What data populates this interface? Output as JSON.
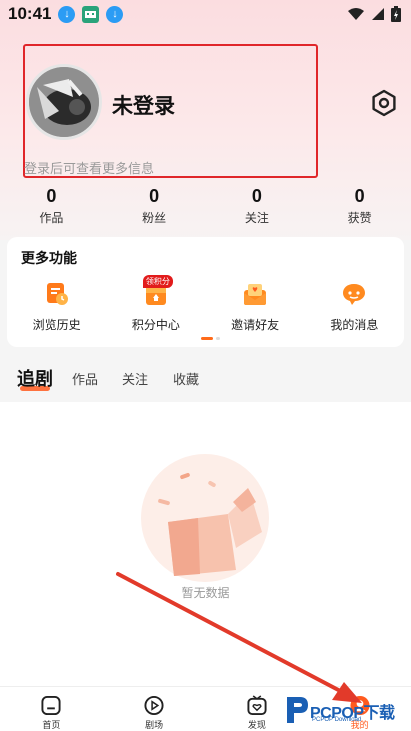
{
  "status_bar": {
    "time": "10:41",
    "left_icons": [
      "download-icon",
      "app-icon",
      "download-icon"
    ],
    "right_icons": [
      "wifi-icon",
      "signal-icon",
      "battery-icon"
    ]
  },
  "profile": {
    "nickname": "未登录",
    "login_hint": "登录后可查看更多信息"
  },
  "stats": [
    {
      "value": "0",
      "label": "作品"
    },
    {
      "value": "0",
      "label": "粉丝"
    },
    {
      "value": "0",
      "label": "关注"
    },
    {
      "value": "0",
      "label": "获赞"
    }
  ],
  "more_functions": {
    "title": "更多功能",
    "items": [
      {
        "label": "浏览历史",
        "icon": "history-icon"
      },
      {
        "label": "积分中心",
        "icon": "points-icon",
        "badge": "领积分"
      },
      {
        "label": "邀请好友",
        "icon": "invite-icon"
      },
      {
        "label": "我的消息",
        "icon": "message-icon"
      }
    ]
  },
  "content_tabs": [
    {
      "label": "追剧",
      "active": true
    },
    {
      "label": "作品",
      "active": false
    },
    {
      "label": "关注",
      "active": false
    },
    {
      "label": "收藏",
      "active": false
    }
  ],
  "empty_state": {
    "text": "暂无数据"
  },
  "bottom_nav": [
    {
      "label": "首页",
      "icon": "home-icon",
      "active": false
    },
    {
      "label": "剧场",
      "icon": "theater-icon",
      "active": false
    },
    {
      "label": "发现",
      "icon": "discover-icon",
      "active": false
    },
    {
      "label": "我的",
      "icon": "profile-icon",
      "active": true
    }
  ],
  "watermark": {
    "text": "PCPOP下载",
    "sub": "PCPOP Download"
  },
  "colors": {
    "accent": "#ff5a1f",
    "highlight_box": "#e0262a",
    "header_gradient_top": "#fbdde0",
    "arrow": "#e23a2a"
  }
}
